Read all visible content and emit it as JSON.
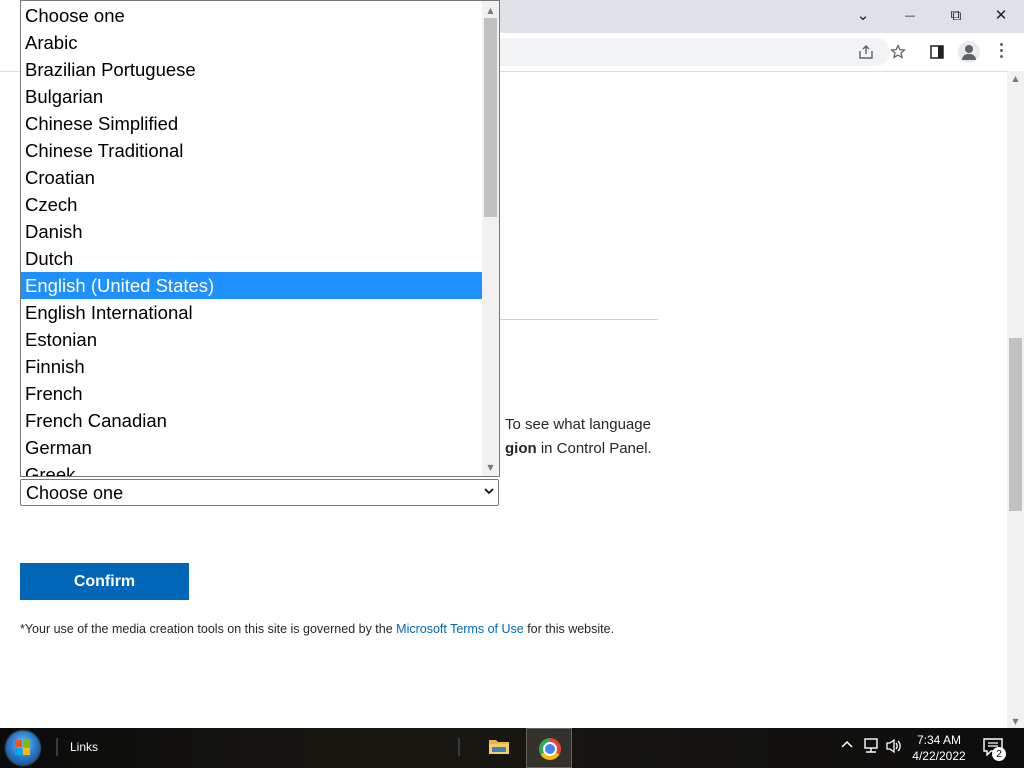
{
  "window": {
    "controls": {
      "tabs_menu": "⌄",
      "minimize": "—",
      "restore": "⧉",
      "close": "✕"
    }
  },
  "toolbar": {
    "icons": [
      "share-icon",
      "star-icon",
      "sidepanel-icon",
      "profile-icon",
      "menu-icon"
    ]
  },
  "page": {
    "line1_text": "To see what language",
    "line2_bold": "gion",
    "line2_rest": " in Control Panel.",
    "select_value": "Choose one",
    "confirm_label": "Confirm",
    "terms_prefix": "*Your use of the media creation tools on this site is governed by the ",
    "terms_link": "Microsoft Terms of Use",
    "terms_suffix": " for this website."
  },
  "dropdown": {
    "options": [
      "Choose one",
      "Arabic",
      "Brazilian Portuguese",
      "Bulgarian",
      "Chinese Simplified",
      "Chinese Traditional",
      "Croatian",
      "Czech",
      "Danish",
      "Dutch",
      "English (United States)",
      "English International",
      "Estonian",
      "Finnish",
      "French",
      "French Canadian",
      "German",
      "Greek"
    ],
    "highlighted": "English (United States)"
  },
  "taskbar": {
    "links_label": "Links",
    "time": "7:34 AM",
    "date": "4/22/2022",
    "notification_count": "2",
    "icons": [
      "start-icon",
      "folder-icon",
      "chrome-icon",
      "chevron-up-icon",
      "network-icon",
      "volume-icon",
      "notification-icon"
    ]
  },
  "colors": {
    "accent": "#0067b8",
    "selection": "#1e90ff"
  }
}
